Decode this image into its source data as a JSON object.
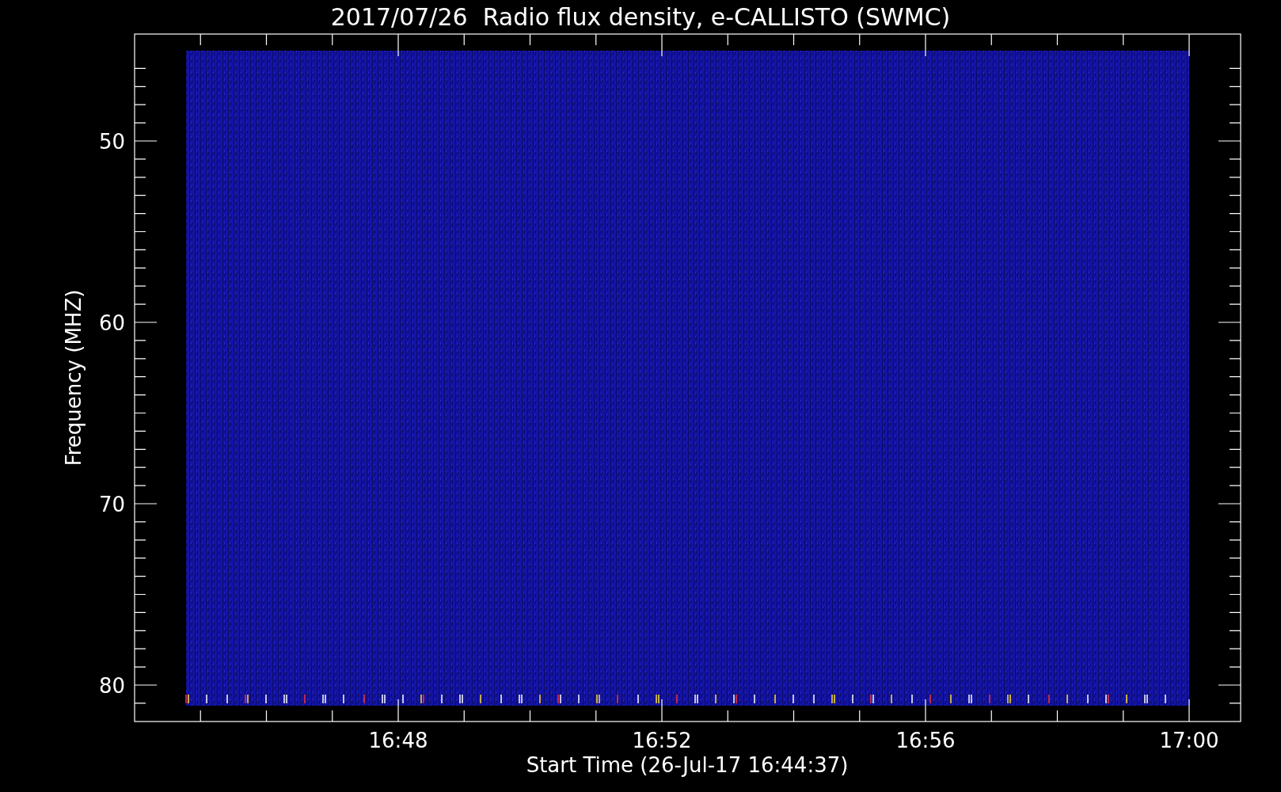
{
  "plot": {
    "title": "2017/07/26  Radio flux density, e-CALLISTO (SWMC)",
    "xlabel": "Start Time (26-Jul-17 16:44:37)",
    "ylabel": "Frequency (MHZ)",
    "yticks": [
      "50",
      "60",
      "70",
      "80"
    ],
    "xticks": [
      "16:48",
      "16:52",
      "16:56",
      "17:00"
    ]
  }
}
